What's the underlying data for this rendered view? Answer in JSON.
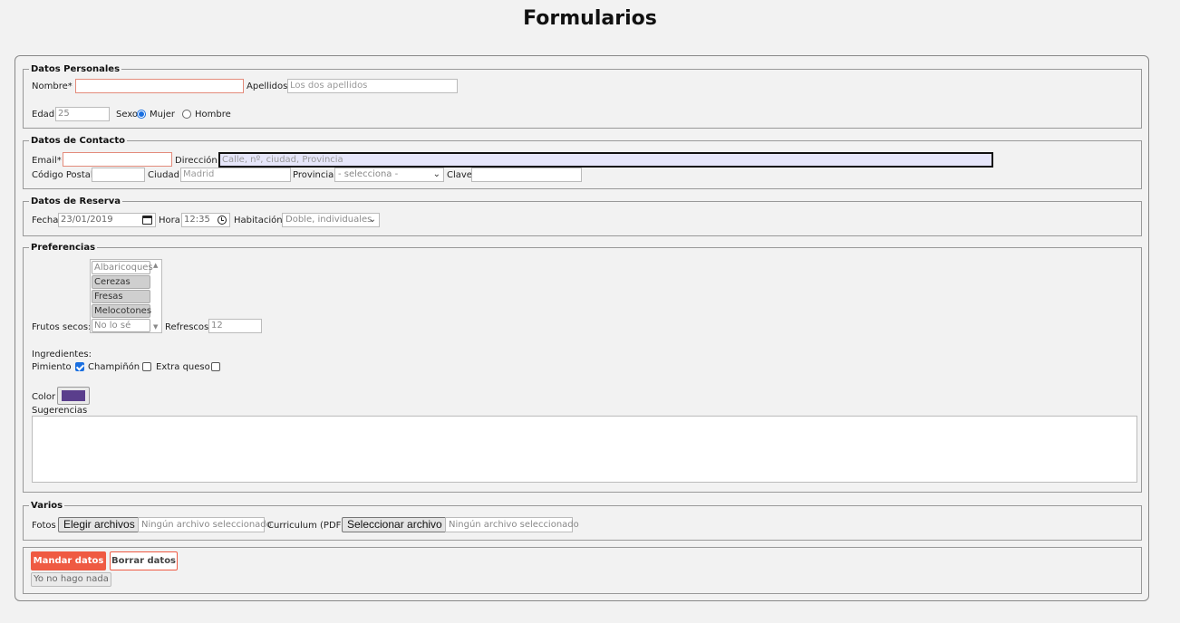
{
  "page": {
    "title": "Formularios"
  },
  "personal": {
    "legend": "Datos Personales",
    "nombre_label": "Nombre*",
    "apellidos_label": "Apellidos",
    "apellidos_placeholder": "Los dos apellidos",
    "edad_label": "Edad",
    "edad_value": "25",
    "sexo_label": "Sexo",
    "sexo_options": [
      "Mujer",
      "Hombre"
    ],
    "sexo_selected": "Mujer"
  },
  "contact": {
    "legend": "Datos de Contacto",
    "email_label": "Email*",
    "direccion_label": "Dirección",
    "direccion_placeholder": "Calle, nº, ciudad, Provincia",
    "cp_label": "Código Postal",
    "ciudad_label": "Ciudad",
    "ciudad_placeholder": "Madrid",
    "provincia_label": "Provincia",
    "provincia_value": "- selecciona -",
    "clave_label": "Clave"
  },
  "reserva": {
    "legend": "Datos de Reserva",
    "fecha_label": "Fecha",
    "fecha_value": "23/01/2019",
    "hora_label": "Hora",
    "hora_value": "12:35",
    "habitacion_label": "Habitación",
    "habitacion_value": "Doble, individuales"
  },
  "preferencias": {
    "legend": "Preferencias",
    "frutos_label": "Frutos secos:",
    "frutos_options": [
      {
        "label": "Albaricoques",
        "selected": false
      },
      {
        "label": "Cerezas",
        "selected": true
      },
      {
        "label": "Fresas",
        "selected": true
      },
      {
        "label": "Melocotones",
        "selected": true
      },
      {
        "label": "No lo sé",
        "selected": false
      }
    ],
    "refrescos_label": "Refrescos",
    "refrescos_value": "12",
    "ingredientes_label": "Ingredientes:",
    "ingredientes": [
      {
        "label": "Pimiento",
        "checked": true
      },
      {
        "label": "Champiñón",
        "checked": false
      },
      {
        "label": "Extra queso",
        "checked": false
      }
    ],
    "color_label": "Color",
    "color_value": "#5a3e8c",
    "sugerencias_label": "Sugerencias"
  },
  "varios": {
    "legend": "Varios",
    "fotos_label": "Fotos",
    "fotos_button": "Elegir archivos",
    "fotos_status": "Ningún archivo seleccionado",
    "cv_label": "Curriculum (PDF)",
    "cv_button": "Seleccionar archivo",
    "cv_status": "Ningún archivo seleccionado"
  },
  "actions": {
    "submit_label": "Mandar datos",
    "reset_label": "Borrar datos",
    "noop_label": "Yo no hago nada"
  },
  "colors": {
    "accent": "#ef5a42",
    "radio": "#1a6fe0"
  }
}
